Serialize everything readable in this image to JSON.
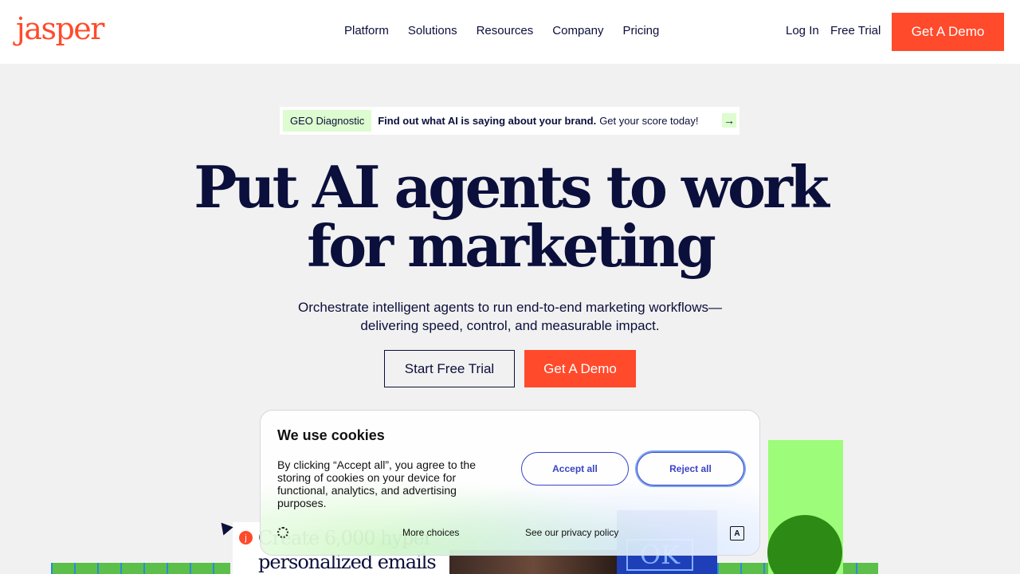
{
  "header": {
    "logo": "jasper",
    "nav": [
      "Platform",
      "Solutions",
      "Resources",
      "Company",
      "Pricing"
    ],
    "login": "Log In",
    "free_trial": "Free Trial",
    "demo": "Get A Demo"
  },
  "banner": {
    "tag": "GEO Diagnostic",
    "strong": "Find out what AI is saying about your brand.",
    "text": "Get your score today!",
    "arrow": "→"
  },
  "hero": {
    "title_line1": "Put AI agents to work",
    "title_line2": "for marketing",
    "subtitle_line1": "Orchestrate intelligent agents to run end-to-end marketing workflows—",
    "subtitle_line2": "delivering speed, control, and measurable impact.",
    "primary_cta": "Start Free Trial",
    "secondary_cta": "Get A Demo"
  },
  "background": {
    "email_text": "Create 6,000 hyper personalized emails",
    "badge": "j",
    "blue_text": "OK"
  },
  "cookie": {
    "title": "We use cookies",
    "body": "By clicking “Accept all”, you agree to the storing of cookies on your device for functional, analytics, and advertising purposes.",
    "accept": "Accept all",
    "reject": "Reject all",
    "more": "More choices",
    "privacy": "See our privacy policy",
    "lang_icon": "A"
  }
}
